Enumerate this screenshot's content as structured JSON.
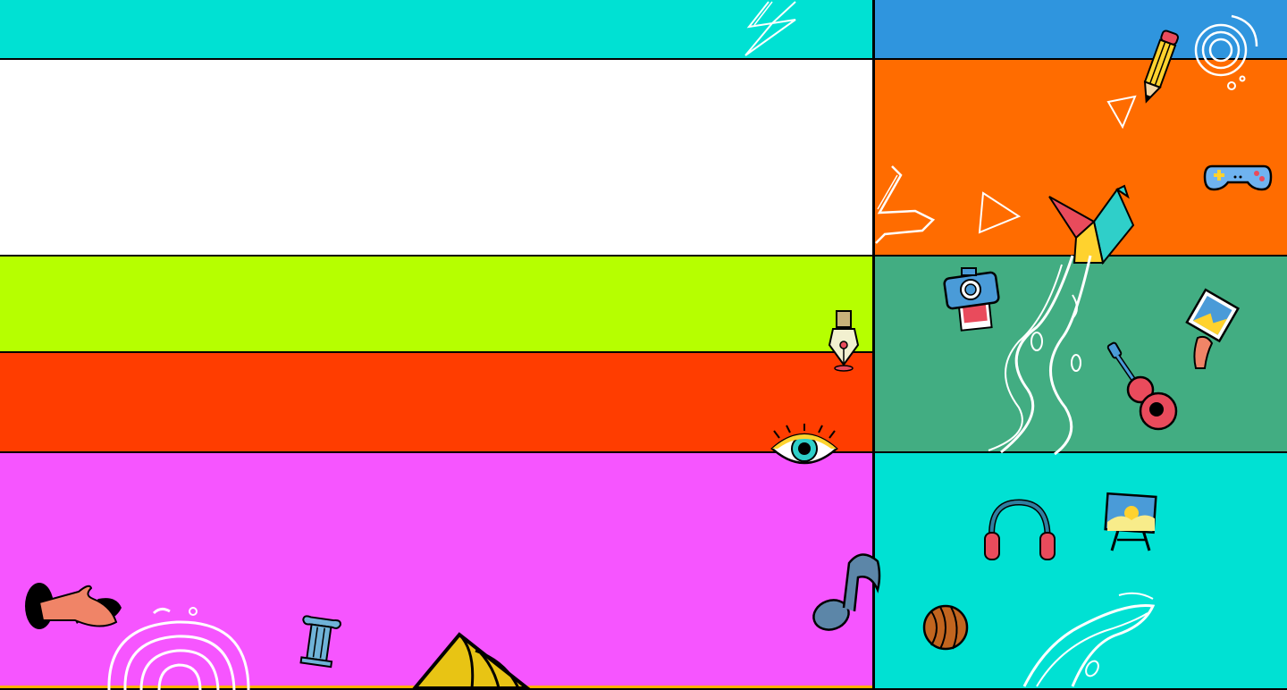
{
  "palette": {
    "cyan": "#00E1D3",
    "white": "#FFFFFF",
    "lime": "#B6FF00",
    "red_orange": "#FF3D00",
    "magenta": "#F655FF",
    "blue": "#2F95DE",
    "orange": "#FF6C00",
    "green": "#42AD82",
    "cyan_right": "#00E1D3",
    "bottom_strip": "#FFB000",
    "outline": "#000000"
  },
  "icons": [
    "lightning-icon",
    "pencil-icon",
    "spiral-icon",
    "triangle-icon",
    "gamepad-icon",
    "zigzag-icon",
    "origami-crane-icon",
    "camera-icon",
    "photo-card-icon",
    "guitar-icon",
    "pen-nib-icon",
    "eye-icon",
    "music-note-icon",
    "headphones-icon",
    "easel-icon",
    "ball-icon",
    "hand-icon",
    "fingerprint-icon",
    "column-icon",
    "hat-icon",
    "wave-icon"
  ]
}
